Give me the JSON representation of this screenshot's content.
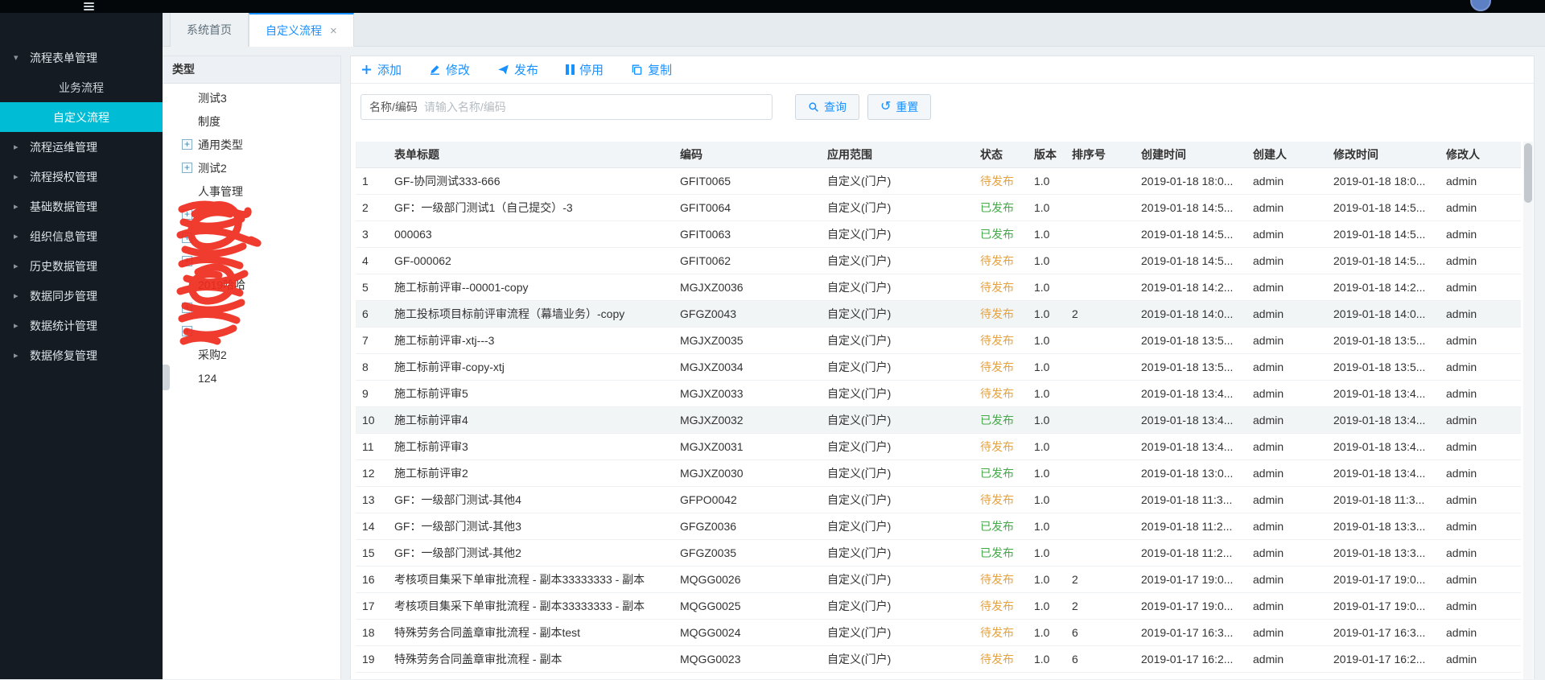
{
  "colors": {
    "accent": "#1890ff",
    "pending": "#e6a23c",
    "published": "#44a948",
    "active_menu": "#00bcd4"
  },
  "tabs": [
    {
      "label": "系统首页",
      "active": false,
      "closable": false
    },
    {
      "label": "自定义流程",
      "active": true,
      "closable": true
    }
  ],
  "sidebar": {
    "items": [
      {
        "label": "流程表单管理",
        "caret": "down",
        "children": [
          {
            "label": "业务流程",
            "active": false
          },
          {
            "label": "自定义流程",
            "active": true
          }
        ]
      },
      {
        "label": "流程运维管理",
        "caret": "right"
      },
      {
        "label": "流程授权管理",
        "caret": "right"
      },
      {
        "label": "基础数据管理",
        "caret": "right"
      },
      {
        "label": "组织信息管理",
        "caret": "right"
      },
      {
        "label": "历史数据管理",
        "caret": "right"
      },
      {
        "label": "数据同步管理",
        "caret": "right"
      },
      {
        "label": "数据统计管理",
        "caret": "right"
      },
      {
        "label": "数据修复管理",
        "caret": "right"
      }
    ]
  },
  "tree": {
    "header": "类型",
    "items": [
      {
        "label": "测试3",
        "expandable": false,
        "obscured": false
      },
      {
        "label": "制度",
        "expandable": false,
        "obscured": false
      },
      {
        "label": "通用类型",
        "expandable": true,
        "obscured": false
      },
      {
        "label": "测试2",
        "expandable": true,
        "obscured": false
      },
      {
        "label": "人事管理",
        "expandable": false,
        "obscured": false
      },
      {
        "label": "",
        "expandable": true,
        "obscured": true
      },
      {
        "label": "",
        "expandable": true,
        "obscured": true
      },
      {
        "label": "",
        "expandable": true,
        "obscured": true
      },
      {
        "label": "2019哈哈",
        "expandable": false,
        "obscured": true
      },
      {
        "label": "",
        "expandable": true,
        "obscured": true
      },
      {
        "label": "",
        "expandable": true,
        "obscured": true
      },
      {
        "label": "采购2",
        "expandable": false,
        "obscured": false
      },
      {
        "label": "124",
        "expandable": false,
        "obscured": false
      }
    ]
  },
  "toolbar": {
    "buttons": [
      {
        "id": "add",
        "label": "添加"
      },
      {
        "id": "edit",
        "label": "修改"
      },
      {
        "id": "publish",
        "label": "发布"
      },
      {
        "id": "suspend",
        "label": "停用"
      },
      {
        "id": "copy",
        "label": "复制"
      }
    ]
  },
  "search": {
    "label": "名称/编码",
    "placeholder": "请输入名称/编码",
    "query_label": "查询",
    "reset_label": "重置"
  },
  "table": {
    "columns": [
      "",
      "表单标题",
      "编码",
      "应用范围",
      "状态",
      "版本",
      "排序号",
      "创建时间",
      "创建人",
      "修改时间",
      "修改人"
    ],
    "rows": [
      {
        "seq": 1,
        "title": "GF-协同测试333-666",
        "code": "GFIT0065",
        "scope": "自定义(门户)",
        "status": "待发布",
        "status_type": "pending",
        "version": "1.0",
        "sort": "",
        "created": "2019-01-18 18:0...",
        "creator": "admin",
        "modified": "2019-01-18 18:0...",
        "modifier": "admin"
      },
      {
        "seq": 2,
        "title": "GF：一级部门测试1（自己提交）-3",
        "code": "GFIT0064",
        "scope": "自定义(门户)",
        "status": "已发布",
        "status_type": "published",
        "version": "1.0",
        "sort": "",
        "created": "2019-01-18 14:5...",
        "creator": "admin",
        "modified": "2019-01-18 14:5...",
        "modifier": "admin"
      },
      {
        "seq": 3,
        "title": "000063",
        "code": "GFIT0063",
        "scope": "自定义(门户)",
        "status": "已发布",
        "status_type": "published",
        "version": "1.0",
        "sort": "",
        "created": "2019-01-18 14:5...",
        "creator": "admin",
        "modified": "2019-01-18 14:5...",
        "modifier": "admin"
      },
      {
        "seq": 4,
        "title": "GF-000062",
        "code": "GFIT0062",
        "scope": "自定义(门户)",
        "status": "待发布",
        "status_type": "pending",
        "version": "1.0",
        "sort": "",
        "created": "2019-01-18 14:5...",
        "creator": "admin",
        "modified": "2019-01-18 14:5...",
        "modifier": "admin"
      },
      {
        "seq": 5,
        "title": "施工标前评审--00001-copy",
        "code": "MGJXZ0036",
        "scope": "自定义(门户)",
        "status": "待发布",
        "status_type": "pending",
        "version": "1.0",
        "sort": "",
        "created": "2019-01-18 14:2...",
        "creator": "admin",
        "modified": "2019-01-18 14:2...",
        "modifier": "admin"
      },
      {
        "seq": 6,
        "title": "施工投标项目标前评审流程（幕墙业务）-copy",
        "code": "GFGZ0043",
        "scope": "自定义(门户)",
        "status": "待发布",
        "status_type": "pending",
        "version": "1.0",
        "sort": "2",
        "created": "2019-01-18 14:0...",
        "creator": "admin",
        "modified": "2019-01-18 14:0...",
        "modifier": "admin"
      },
      {
        "seq": 7,
        "title": "施工标前评审-xtj---3",
        "code": "MGJXZ0035",
        "scope": "自定义(门户)",
        "status": "待发布",
        "status_type": "pending",
        "version": "1.0",
        "sort": "",
        "created": "2019-01-18 13:5...",
        "creator": "admin",
        "modified": "2019-01-18 13:5...",
        "modifier": "admin"
      },
      {
        "seq": 8,
        "title": "施工标前评审-copy-xtj",
        "code": "MGJXZ0034",
        "scope": "自定义(门户)",
        "status": "待发布",
        "status_type": "pending",
        "version": "1.0",
        "sort": "",
        "created": "2019-01-18 13:5...",
        "creator": "admin",
        "modified": "2019-01-18 13:5...",
        "modifier": "admin"
      },
      {
        "seq": 9,
        "title": "施工标前评审5",
        "code": "MGJXZ0033",
        "scope": "自定义(门户)",
        "status": "待发布",
        "status_type": "pending",
        "version": "1.0",
        "sort": "",
        "created": "2019-01-18 13:4...",
        "creator": "admin",
        "modified": "2019-01-18 13:4...",
        "modifier": "admin"
      },
      {
        "seq": 10,
        "title": "施工标前评审4",
        "code": "MGJXZ0032",
        "scope": "自定义(门户)",
        "status": "已发布",
        "status_type": "published",
        "version": "1.0",
        "sort": "",
        "created": "2019-01-18 13:4...",
        "creator": "admin",
        "modified": "2019-01-18 13:4...",
        "modifier": "admin"
      },
      {
        "seq": 11,
        "title": "施工标前评审3",
        "code": "MGJXZ0031",
        "scope": "自定义(门户)",
        "status": "待发布",
        "status_type": "pending",
        "version": "1.0",
        "sort": "",
        "created": "2019-01-18 13:4...",
        "creator": "admin",
        "modified": "2019-01-18 13:4...",
        "modifier": "admin"
      },
      {
        "seq": 12,
        "title": "施工标前评审2",
        "code": "MGJXZ0030",
        "scope": "自定义(门户)",
        "status": "已发布",
        "status_type": "published",
        "version": "1.0",
        "sort": "",
        "created": "2019-01-18 13:0...",
        "creator": "admin",
        "modified": "2019-01-18 13:4...",
        "modifier": "admin"
      },
      {
        "seq": 13,
        "title": "GF：一级部门测试-其他4",
        "code": "GFPO0042",
        "scope": "自定义(门户)",
        "status": "待发布",
        "status_type": "pending",
        "version": "1.0",
        "sort": "",
        "created": "2019-01-18 11:3...",
        "creator": "admin",
        "modified": "2019-01-18 11:3...",
        "modifier": "admin"
      },
      {
        "seq": 14,
        "title": "GF：一级部门测试-其他3",
        "code": "GFGZ0036",
        "scope": "自定义(门户)",
        "status": "已发布",
        "status_type": "published",
        "version": "1.0",
        "sort": "",
        "created": "2019-01-18 11:2...",
        "creator": "admin",
        "modified": "2019-01-18 13:3...",
        "modifier": "admin"
      },
      {
        "seq": 15,
        "title": "GF：一级部门测试-其他2",
        "code": "GFGZ0035",
        "scope": "自定义(门户)",
        "status": "已发布",
        "status_type": "published",
        "version": "1.0",
        "sort": "",
        "created": "2019-01-18 11:2...",
        "creator": "admin",
        "modified": "2019-01-18 13:3...",
        "modifier": "admin"
      },
      {
        "seq": 16,
        "title": "考核项目集采下单审批流程 - 副本33333333 - 副本",
        "code": "MQGG0026",
        "scope": "自定义(门户)",
        "status": "待发布",
        "status_type": "pending",
        "version": "1.0",
        "sort": "2",
        "created": "2019-01-17 19:0...",
        "creator": "admin",
        "modified": "2019-01-17 19:0...",
        "modifier": "admin"
      },
      {
        "seq": 17,
        "title": "考核项目集采下单审批流程 - 副本33333333 - 副本",
        "code": "MQGG0025",
        "scope": "自定义(门户)",
        "status": "待发布",
        "status_type": "pending",
        "version": "1.0",
        "sort": "2",
        "created": "2019-01-17 19:0...",
        "creator": "admin",
        "modified": "2019-01-17 19:0...",
        "modifier": "admin"
      },
      {
        "seq": 18,
        "title": "特殊劳务合同盖章审批流程 - 副本test",
        "code": "MQGG0024",
        "scope": "自定义(门户)",
        "status": "待发布",
        "status_type": "pending",
        "version": "1.0",
        "sort": "6",
        "created": "2019-01-17 16:3...",
        "creator": "admin",
        "modified": "2019-01-17 16:3...",
        "modifier": "admin"
      },
      {
        "seq": 19,
        "title": "特殊劳务合同盖章审批流程 - 副本",
        "code": "MQGG0023",
        "scope": "自定义(门户)",
        "status": "待发布",
        "status_type": "pending",
        "version": "1.0",
        "sort": "6",
        "created": "2019-01-17 16:2...",
        "creator": "admin",
        "modified": "2019-01-17 16:2...",
        "modifier": "admin"
      }
    ]
  }
}
